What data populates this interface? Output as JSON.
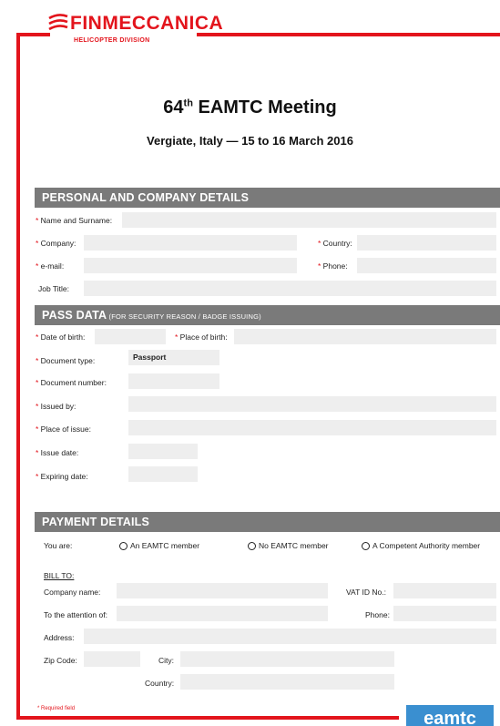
{
  "logo": {
    "brand": "FINMECCANICA",
    "division": "HELICOPTER DIVISION"
  },
  "title": {
    "number": "64",
    "suffix": "th",
    "rest": " EAMTC Meeting"
  },
  "subtitle": "Vergiate, Italy  —  15 to 16 March 2016",
  "required_mark": "* ",
  "personal": {
    "header": "PERSONAL AND COMPANY DETAILS",
    "name_label": "Name and Surname:",
    "company_label": "Company:",
    "country_label": "Country:",
    "email_label": "e-mail:",
    "phone_label": "Phone:",
    "job_label": "Job Title:"
  },
  "pass": {
    "header": "PASS DATA",
    "header_note": " (FOR SECURITY REASON / BADGE ISSUING)",
    "dob_label": "Date of birth:",
    "pob_label": "Place of birth:",
    "doctype_label": "Document type:",
    "doctype_value": "Passport",
    "docnum_label": "Document number:",
    "issuedby_label": "Issued by:",
    "placeissue_label": "Place of issue:",
    "issuedate_label": "Issue date:",
    "expiring_label": "Expiring date:"
  },
  "payment": {
    "header": "PAYMENT DETAILS",
    "you_are": "You are:",
    "options": [
      "An EAMTC member",
      "No EAMTC member",
      "A Competent Authority member"
    ],
    "bill_to": "BILL TO:",
    "company_label": "Company name:",
    "vat_label": "VAT ID No.:",
    "attention_label": "To the attention of:",
    "phone_label": "Phone:",
    "address_label": "Address:",
    "zip_label": "Zip Code:",
    "city_label": "City:",
    "country_label": "Country:"
  },
  "footer": {
    "required_note": "* Required field",
    "eamtc_logo": "eamtc"
  },
  "colors": {
    "accent_red": "#e3141c",
    "header_gray": "#7a7a7a",
    "field_gray": "#eeeeee",
    "eamtc_blue": "#3a8fd0"
  }
}
